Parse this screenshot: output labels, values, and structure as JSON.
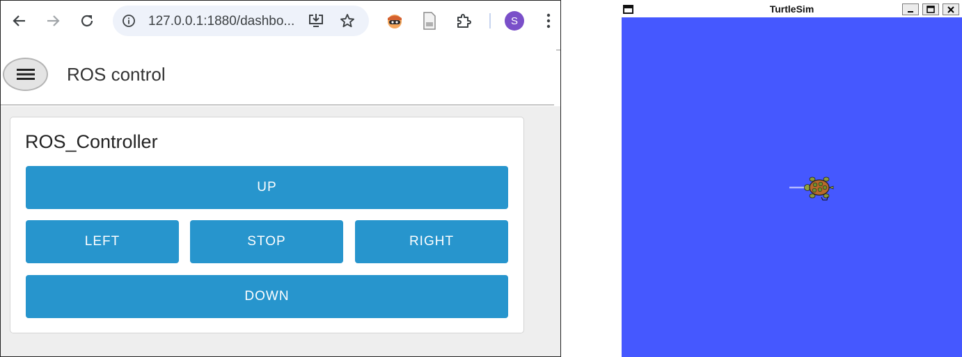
{
  "browser": {
    "url": "127.0.0.1:1880/dashbo...",
    "profile_initial": "S",
    "colors": {
      "profile": "#7a4fc9",
      "omnibox": "#eef2fa"
    }
  },
  "app": {
    "title": "ROS control"
  },
  "controller": {
    "title": "ROS_Controller",
    "buttons": {
      "up": "UP",
      "left": "LEFT",
      "stop": "STOP",
      "right": "RIGHT",
      "down": "DOWN"
    },
    "button_color": "#2795cd"
  },
  "turtlesim": {
    "window_title": "TurtleSim",
    "background_color": "#4558ff",
    "pen_color": "#b3b8ff"
  },
  "icons": {
    "back": "back-arrow-icon",
    "forward": "forward-arrow-icon",
    "reload": "reload-icon",
    "site_info": "info-icon",
    "install": "install-app-icon",
    "bookmark": "star-icon",
    "extension_1": "ninja-extension-icon",
    "extension_2": "document-extension-icon",
    "extensions": "puzzle-icon",
    "menu": "kebab-menu-icon",
    "hamburger": "hamburger-icon",
    "turtle": "turtle-icon"
  }
}
